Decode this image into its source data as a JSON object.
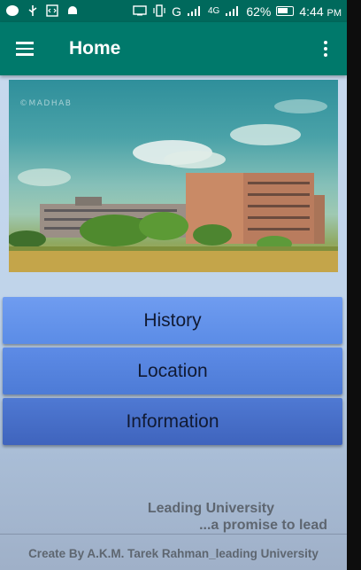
{
  "status_bar": {
    "signal_label": "G",
    "network_label": "4G",
    "battery": "62%",
    "time": "4:44",
    "ampm": "PM"
  },
  "app_bar": {
    "title": "Home"
  },
  "banner": {
    "watermark": "©MADHAB"
  },
  "buttons": {
    "history": "History",
    "location": "Location",
    "information": "Information"
  },
  "tagline": {
    "line1": "Leading University",
    "line2": "...a promise to lead"
  },
  "footer": {
    "credit": "Create By A.K.M. Tarek Rahman_leading University"
  }
}
